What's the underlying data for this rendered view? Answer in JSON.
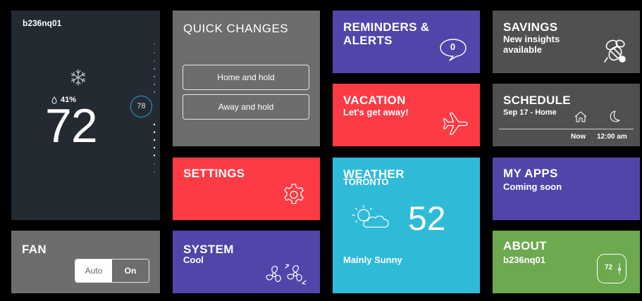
{
  "thermostat": {
    "device_name": "b236nq01",
    "humidity": "41%",
    "current_temp": "72",
    "setpoint": "78",
    "mode_icon": "snowflake-icon"
  },
  "fan": {
    "title": "FAN",
    "options": [
      "Auto",
      "On"
    ],
    "selected": "On"
  },
  "quick_changes": {
    "title": "QUICK CHANGES",
    "buttons": [
      "Home and hold",
      "Away and hold"
    ]
  },
  "settings": {
    "title": "SETTINGS",
    "icon": "gear-icon"
  },
  "system": {
    "title": "SYSTEM",
    "subtitle": "Cool",
    "icon": "fan-icon"
  },
  "reminders": {
    "title": "REMINDERS & ALERTS",
    "count": "0",
    "icon": "speech-bubble-icon"
  },
  "vacation": {
    "title": "VACATION",
    "subtitle": "Let's get away!",
    "icon": "airplane-icon"
  },
  "weather": {
    "title": "WEATHER",
    "city": "TORONTO",
    "temp": "52",
    "condition": "Mainly Sunny",
    "icon": "partly-sunny-icon"
  },
  "savings": {
    "title": "SAVINGS",
    "subtitle": "New insights available",
    "icon": "bee-icon"
  },
  "schedule": {
    "title": "SCHEDULE",
    "subtitle": "Sep 17 - Home",
    "now_label": "Now",
    "next_time": "12:00 am"
  },
  "my_apps": {
    "title": "MY APPS",
    "subtitle": "Coming soon"
  },
  "about": {
    "title": "ABOUT",
    "subtitle": "b236nq01",
    "mini_temp": "72"
  },
  "colors": {
    "thermostat_bg": "#232a31",
    "gray_tile": "#6d6d6d",
    "dark_gray_tile": "#505050",
    "red_tile": "#fc3b45",
    "purple_tile": "#5245a9",
    "cyan_tile": "#2fbbd8",
    "green_tile": "#6da94f",
    "setpoint_blue": "#2d9fd9"
  }
}
